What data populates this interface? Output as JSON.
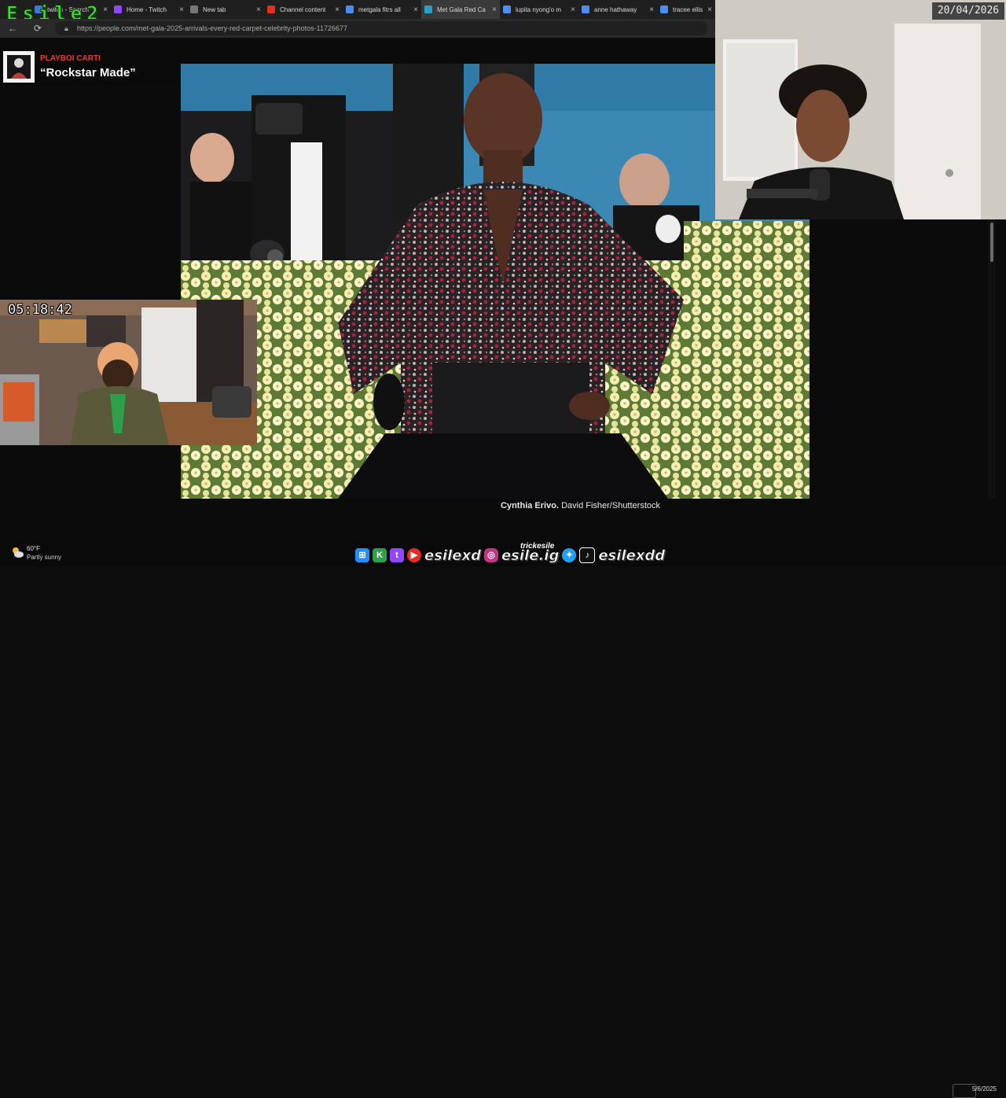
{
  "stream_logo": "Esile2",
  "browser": {
    "tabs": [
      {
        "label": "twitch - Search",
        "color": "#3b7bd8"
      },
      {
        "label": "Home - Twitch",
        "color": "#9146ff"
      },
      {
        "label": "New tab",
        "color": "#777777"
      },
      {
        "label": "Channel content",
        "color": "#e0311f"
      },
      {
        "label": "metgala fitrs all",
        "color": "#4e8cf0"
      },
      {
        "label": "Met Gala Red Ca",
        "color": "#2aa0c9"
      },
      {
        "label": "lupita nyong'o m",
        "color": "#4e8cf0"
      },
      {
        "label": "anne hathaway",
        "color": "#4e8cf0"
      },
      {
        "label": "tracee ellis ros",
        "color": "#4e8cf0"
      }
    ],
    "active_tab": 5,
    "url": "https://people.com/met-gala-2025-arrivals-every-red-carpet-celebrity-photos-11726677"
  },
  "now_playing": {
    "artist": "PLAYBOI CARTI",
    "song": "“Rockstar Made”"
  },
  "timer": "05:18:42",
  "date": "20/04/2026",
  "article": {
    "caption_name": "Cynthia Erivo.",
    "caption_credit": "David Fisher/Shutterstock"
  },
  "taskbar": {
    "temperature": "60°F",
    "weather": "Partly sunny",
    "handles": [
      "esilexd",
      "esile.ig",
      "esilexdd"
    ],
    "ig_top_label": "trickesile",
    "clock_date": "5/6/2025"
  },
  "colors": {
    "accent_green": "#4ade35",
    "artist_red": "#e0413a",
    "photo_bg": "#3b88b4"
  }
}
